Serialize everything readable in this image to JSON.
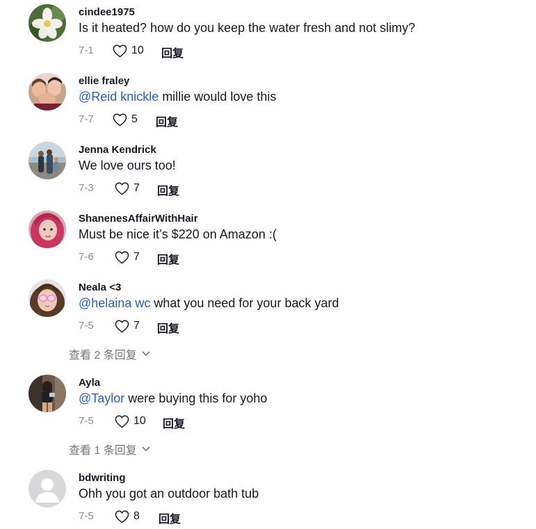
{
  "comments": [
    {
      "username": "cindee1975",
      "mention": "",
      "text": "Is it heated? how do you keep the water fresh and not slimy?",
      "date": "7-1",
      "likes": "10",
      "reply_label": "回复",
      "avatar": "flower"
    },
    {
      "username": "ellie fraley",
      "mention": "@Reid knickle",
      "text": " millie would love this",
      "date": "7-7",
      "likes": "5",
      "reply_label": "回复",
      "avatar": "group-selfie"
    },
    {
      "username": "Jenna Kendrick",
      "mention": "",
      "text": "We love ours too!",
      "date": "7-3",
      "likes": "7",
      "reply_label": "回复",
      "avatar": "beach-family"
    },
    {
      "username": "ShanenesAffairWithHair",
      "mention": "",
      "text": "Must be nice it’s $220 on Amazon :(",
      "date": "7-6",
      "likes": "7",
      "reply_label": "回复",
      "avatar": "pink-hair"
    },
    {
      "username": "Neala <3",
      "mention": "@helaina wc",
      "text": " what you need for your back yard",
      "date": "7-5",
      "likes": "7",
      "reply_label": "回复",
      "avatar": "glasses-face"
    },
    {
      "username": "Ayla",
      "mention": "@Taylor",
      "text": " were buying this for yoho",
      "date": "7-5",
      "likes": "10",
      "reply_label": "回复",
      "avatar": "mirror-selfie"
    },
    {
      "username": "bdwriting",
      "mention": "",
      "text": "Ohh you got an outdoor bath tub",
      "date": "7-5",
      "likes": "8",
      "reply_label": "回复",
      "avatar": "default-user"
    }
  ],
  "view_replies": [
    {
      "label": "查看 2 条回复"
    },
    {
      "label": "查看 1 条回复"
    }
  ],
  "icons": {
    "like": "heart-outline-icon",
    "expand": "chevron-down-icon"
  },
  "colors": {
    "mention": "#2b5db9",
    "muted": "#8a8b91",
    "text": "#161823"
  }
}
